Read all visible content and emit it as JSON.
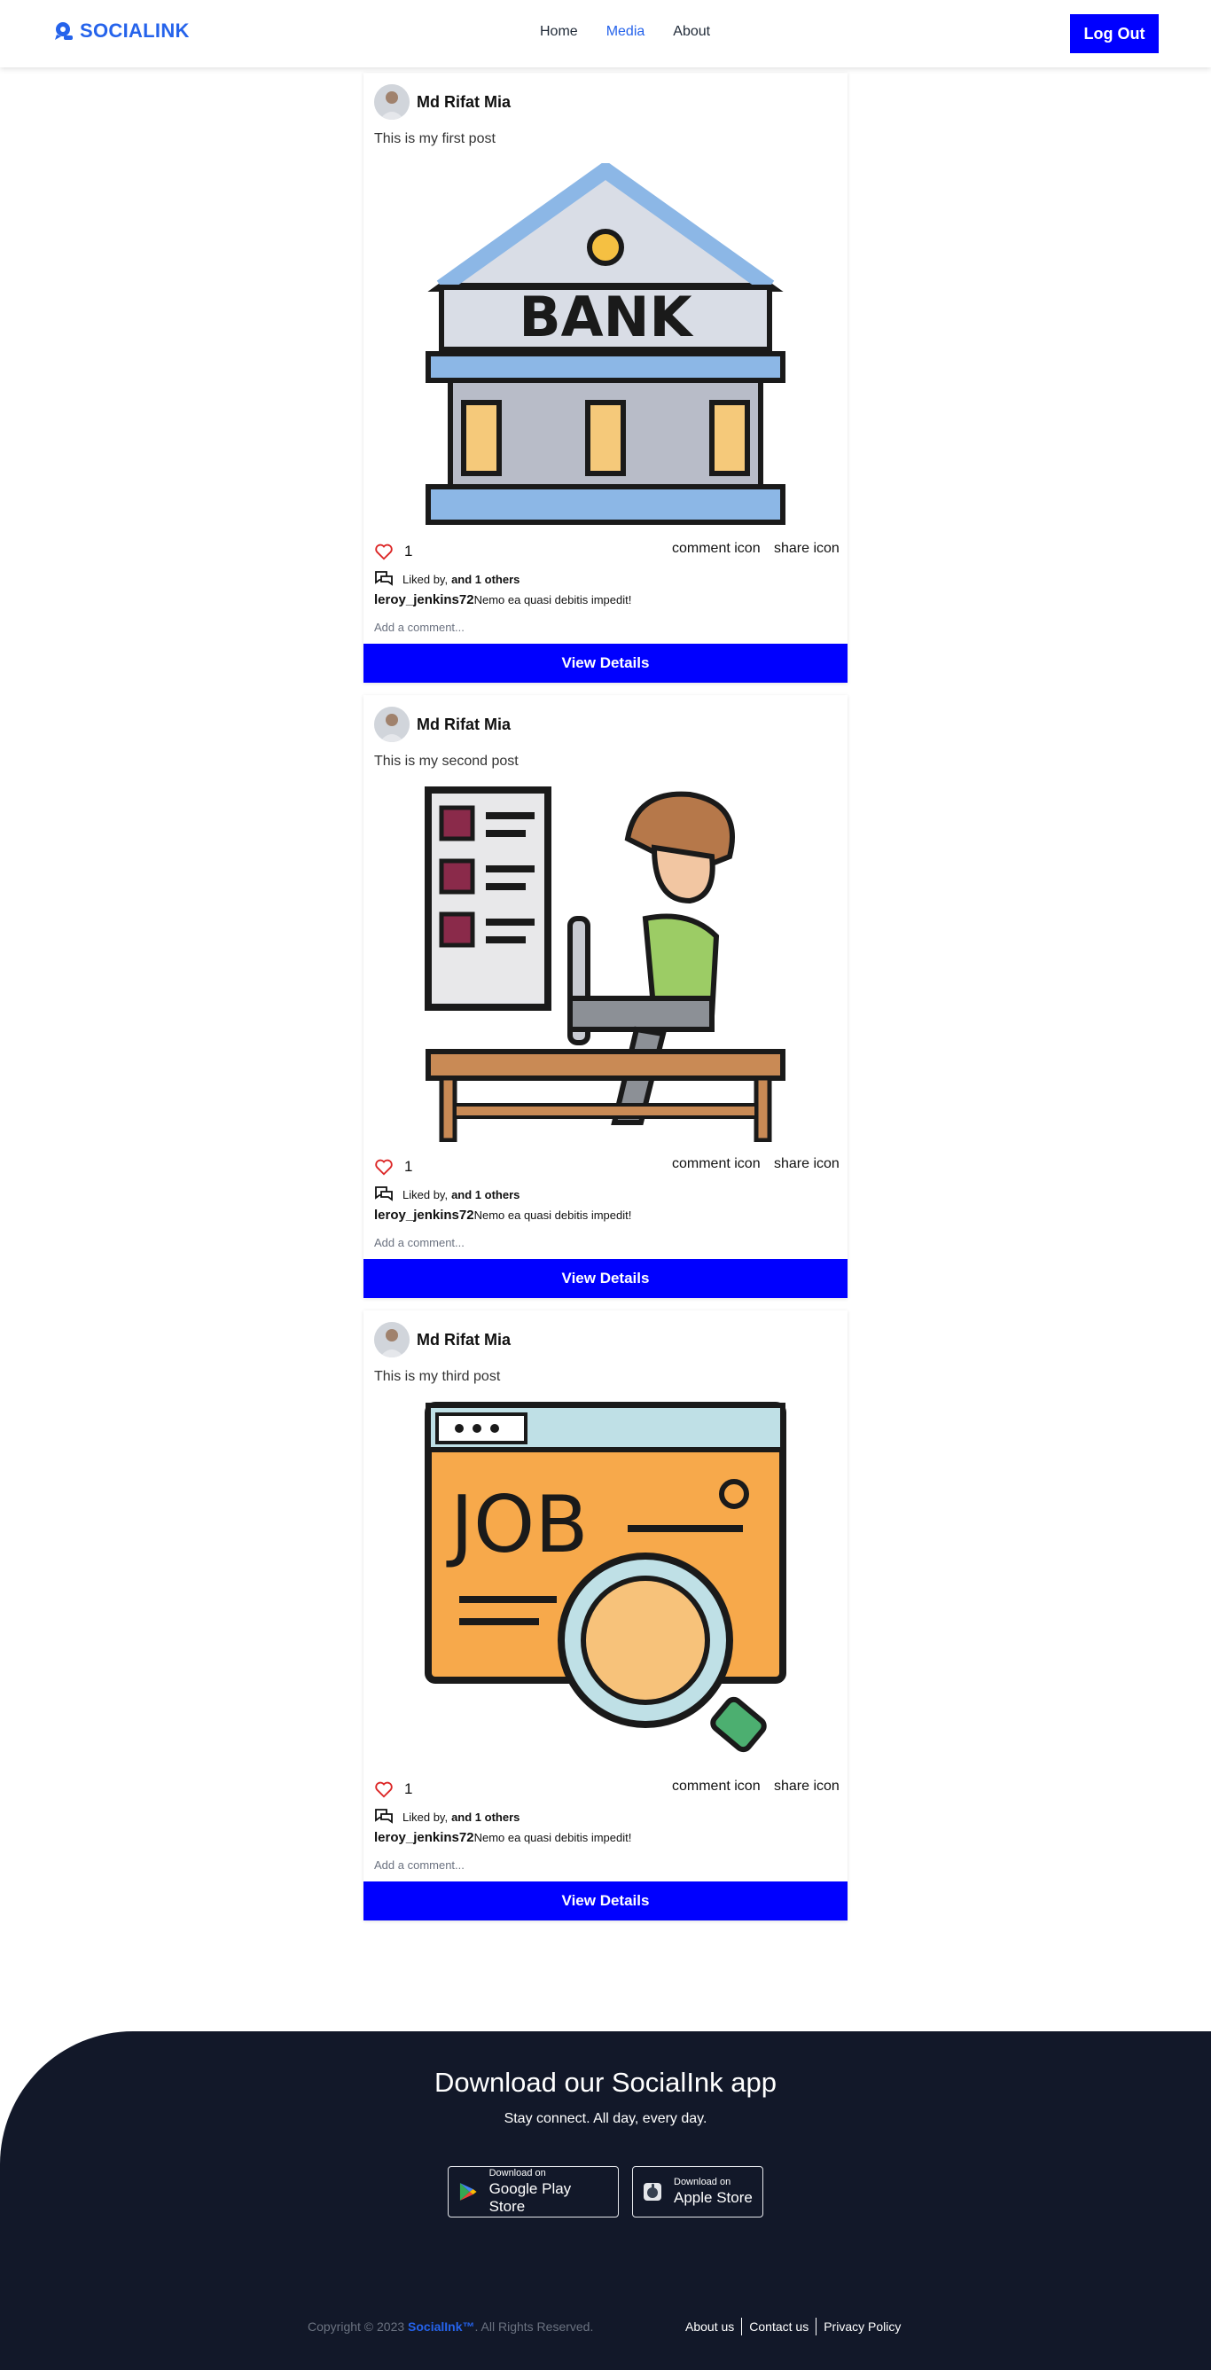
{
  "navbar": {
    "brand": "SOCIALINK",
    "links": [
      "Home",
      "Media",
      "About"
    ],
    "active_link": "Media",
    "logout_label": "Log Out"
  },
  "posts": [
    {
      "author": "Md Rifat Mia",
      "text": "This is my first post",
      "image": "bank-icon",
      "likes": "1",
      "comment_label": "comment icon",
      "share_label": "share icon",
      "liked_by_prefix": "Liked by,",
      "liked_by_others": "and 1 others",
      "comment_user": "leroy_jenkins72",
      "comment_text": "Nemo ea quasi debitis impedit!",
      "add_comment_placeholder": "Add a comment...",
      "details_label": "View Details"
    },
    {
      "author": "Md Rifat Mia",
      "text": "This is my second post",
      "image": "person-at-desk-icon",
      "likes": "1",
      "comment_label": "comment icon",
      "share_label": "share icon",
      "liked_by_prefix": "Liked by,",
      "liked_by_others": "and 1 others",
      "comment_user": "leroy_jenkins72",
      "comment_text": "Nemo ea quasi debitis impedit!",
      "add_comment_placeholder": "Add a comment...",
      "details_label": "View Details"
    },
    {
      "author": "Md Rifat Mia",
      "text": "This is my third post",
      "image": "job-search-icon",
      "likes": "1",
      "comment_label": "comment icon",
      "share_label": "share icon",
      "liked_by_prefix": "Liked by,",
      "liked_by_others": "and 1 others",
      "comment_user": "leroy_jenkins72",
      "comment_text": "Nemo ea quasi debitis impedit!",
      "add_comment_placeholder": "Add a comment...",
      "details_label": "View Details"
    }
  ],
  "footer": {
    "title": "Download our SocialInk app",
    "subtitle": "Stay connect. All day, every day.",
    "google": {
      "small": "Download on",
      "big": "Google Play Store"
    },
    "apple": {
      "small": "Download on",
      "big": "Apple Store"
    },
    "copyright_prefix": "Copyright © 2023",
    "copyright_brand": "SocialInk™",
    "copyright_suffix": ". All Rights Reserved.",
    "links": [
      "About us",
      "Contact us",
      "Privacy Policy"
    ]
  },
  "colors": {
    "brand_blue": "#2563eb",
    "button_blue": "#0000ff",
    "footer_bg": "#121829",
    "heart_red": "#dc2626"
  }
}
